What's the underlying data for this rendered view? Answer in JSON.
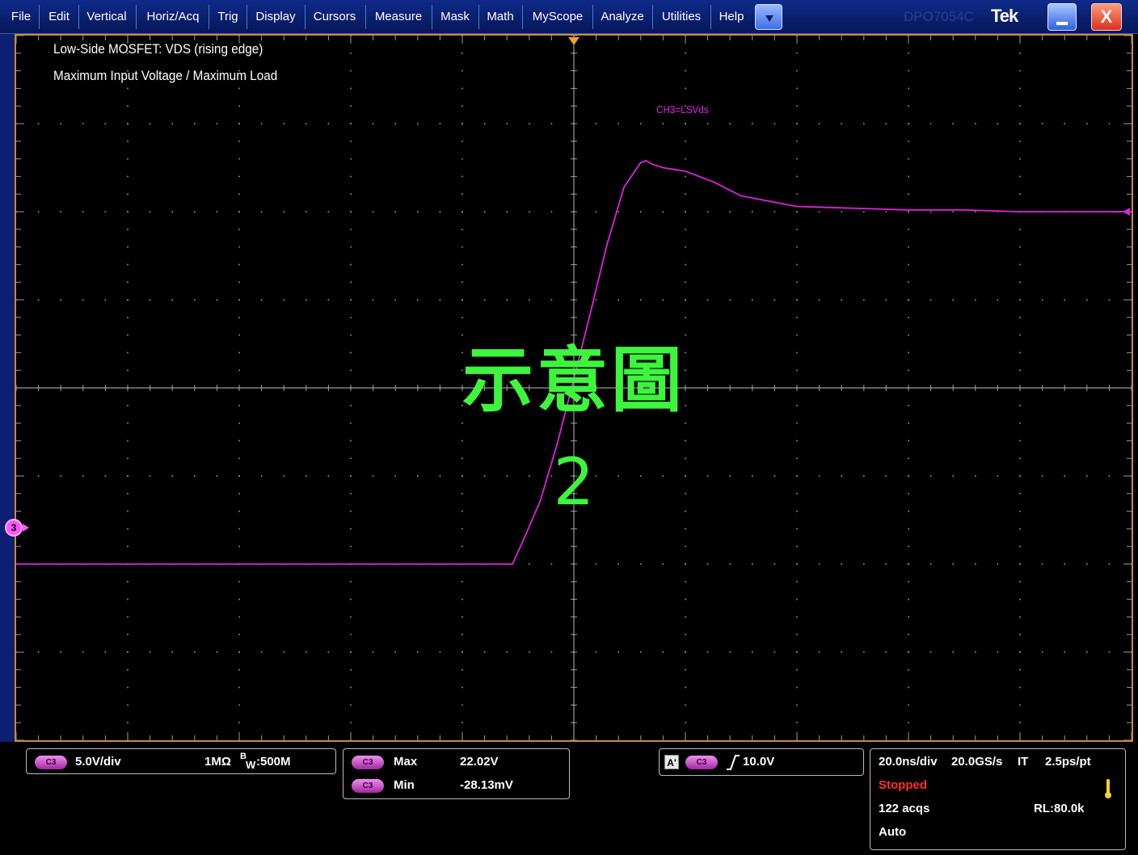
{
  "menu": {
    "items": [
      "File",
      "Edit",
      "Vertical",
      "Horiz/Acq",
      "Trig",
      "Display",
      "Cursors",
      "Measure",
      "Mask",
      "Math",
      "MyScope",
      "Analyze",
      "Utilities",
      "Help"
    ],
    "dropdown_icon": "chevron-down-icon",
    "model_text": "DPO7054C",
    "brand": "Tek",
    "minimize_icon": "minimize-icon",
    "close_label": "X"
  },
  "display": {
    "caption_line1": "Low-Side MOSFET: VDS (rising edge)",
    "caption_line2": "Maximum Input Voltage / Maximum Load",
    "channel_label": "CH3=LSVds",
    "watermark_title": "示意圖",
    "watermark_number": "2",
    "channel_marker": "3",
    "trace_color": "#e020e0",
    "grid_color": "#9a9a9a",
    "frame_color": "#c98a3e",
    "watermark_color": "#3df53d"
  },
  "chart_data": {
    "type": "line",
    "title": "",
    "xlabel": "",
    "ylabel": "",
    "x_unit": "ns",
    "y_unit": "V",
    "x_per_div": 20,
    "y_per_div": 5,
    "xlim": [
      -100,
      100
    ],
    "ylim": [
      -20,
      20
    ],
    "grid": true,
    "series": [
      {
        "name": "CH3=LSVds",
        "x": [
          -100,
          -80,
          -60,
          -40,
          -30,
          -20,
          -11,
          -9,
          -6,
          -3,
          0,
          3,
          6,
          9,
          12,
          13,
          14,
          16,
          18,
          20,
          25,
          30,
          40,
          50,
          60,
          70,
          80,
          90,
          100
        ],
        "y": [
          -10,
          -10,
          -10,
          -10,
          -10,
          -10,
          -10,
          -8.6,
          -6.4,
          -3.2,
          0.5,
          4.3,
          8.2,
          11.4,
          12.8,
          12.9,
          12.7,
          12.5,
          12.4,
          12.3,
          11.7,
          10.9,
          10.3,
          10.2,
          10.1,
          10.1,
          10.0,
          10.0,
          10.0
        ]
      }
    ]
  },
  "status": {
    "ch_badge": "C3",
    "vertical": {
      "scale": "5.0V/div",
      "impedance": "1MΩ",
      "bw_prefix": "B",
      "bw_sub": "W",
      "bw": ":500M"
    },
    "meas": [
      {
        "label": "Max",
        "value": "22.02V"
      },
      {
        "label": "Min",
        "value": "-28.13mV"
      }
    ],
    "trigger": {
      "a_label": "A'",
      "level": "10.0V"
    },
    "horiz": {
      "timebase": "20.0ns/div",
      "rate": "20.0GS/s",
      "mode": "IT",
      "res": "2.5ps/pt",
      "state": "Stopped",
      "acqs": "122 acqs",
      "rl": "RL:80.0k",
      "trig_mode": "Auto"
    },
    "state_color": "#ff3030"
  }
}
